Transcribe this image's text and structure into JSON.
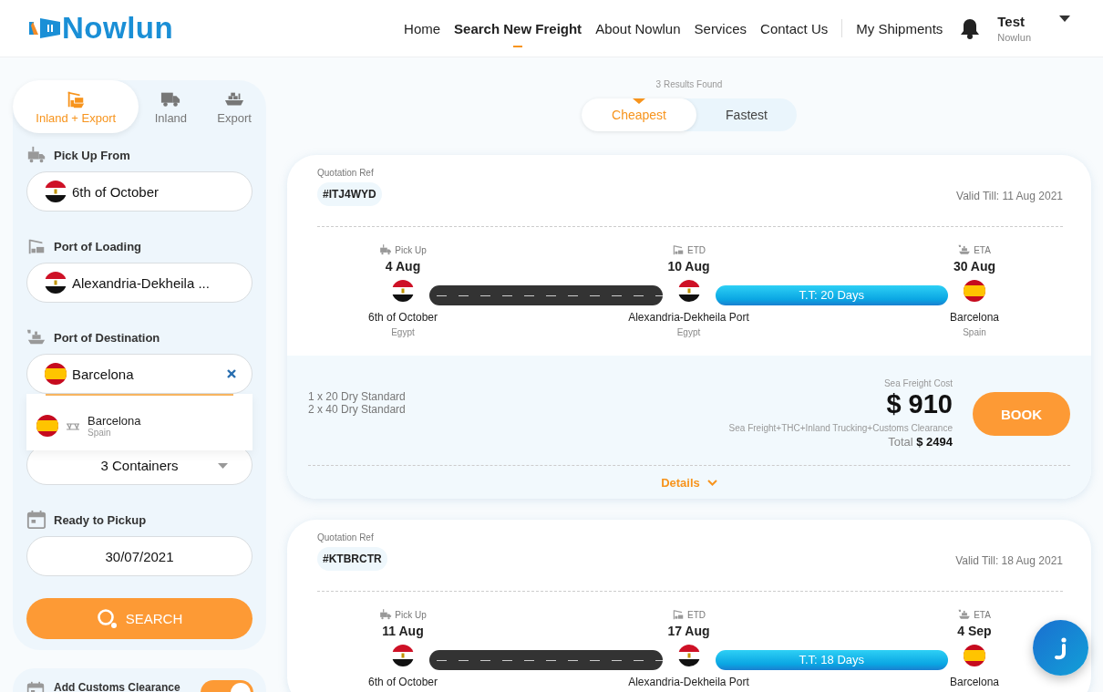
{
  "header": {
    "logo": "Nowlun",
    "nav": [
      {
        "label": "Home",
        "selected": false
      },
      {
        "label": "Search New Freight",
        "selected": true
      },
      {
        "label": "About Nowlun",
        "selected": false
      },
      {
        "label": "Services",
        "selected": false
      },
      {
        "label": "Contact Us",
        "selected": false
      }
    ],
    "my_shipments": "My Shipments",
    "user": {
      "name": "Test",
      "company": "Nowlun"
    }
  },
  "sidebar": {
    "modes": [
      {
        "label": "Inland + Export",
        "selected": true
      },
      {
        "label": "Inland",
        "selected": false
      },
      {
        "label": "Export",
        "selected": false
      }
    ],
    "fields": [
      {
        "kind": "location",
        "label": "Pick Up From",
        "value": "6th of October",
        "flag": {
          "kind": "egypt"
        }
      },
      {
        "kind": "location",
        "label": "Port of Loading",
        "value": "Alexandria-Dekheila ...",
        "flag": {
          "kind": "egypt"
        }
      },
      {
        "kind": "location",
        "label": "Port of Destination",
        "value": "Barcelona",
        "flag": {
          "kind": "spain"
        },
        "clearable": true,
        "suggestions": [
          {
            "name": "Barcelona",
            "country": "Spain",
            "flag": {
              "kind": "spain"
            }
          }
        ]
      },
      {
        "kind": "select",
        "value": "3 Containers"
      },
      {
        "kind": "date",
        "label": "Ready to Pickup",
        "value": "30/07/2021"
      }
    ],
    "search_button": "SEARCH",
    "customs": {
      "label": "Add Customs Clearance",
      "on": true
    }
  },
  "results": {
    "count": "3 Results Found",
    "sort_tabs": [
      {
        "label": "Cheapest",
        "selected": true
      },
      {
        "label": "Fastest",
        "selected": false
      }
    ],
    "quotes": [
      {
        "ref_label": "Quotation Ref",
        "ref": "#ITJ4WYD",
        "valid": "Valid Till: 11 Aug 2021",
        "transit": "T.T: 20 Days",
        "stops": [
          {
            "label": "Pick Up",
            "date": "4 Aug",
            "flag": {
              "kind": "egypt"
            },
            "name": "6th of October",
            "country": "Egypt"
          },
          {
            "label": "ETD",
            "date": "10 Aug",
            "flag": {
              "kind": "egypt"
            },
            "name": "Alexandria-Dekheila Port",
            "country": "Egypt"
          },
          {
            "label": "ETA",
            "date": "30 Aug",
            "flag": {
              "kind": "spain"
            },
            "name": "Barcelona",
            "country": "Spain"
          }
        ],
        "containers": [
          "1 x 20 Dry Standard",
          "2 x 40 Dry Standard"
        ],
        "cost_label": "Sea Freight Cost",
        "price": "$ 910",
        "includes": "Sea Freight+THC+Inland Trucking+Customs Clearance",
        "total_label": "Total",
        "total": "$ 2494",
        "book": "BOOK",
        "details": "Details"
      },
      {
        "ref_label": "Quotation Ref",
        "ref": "#KTBRCTR",
        "valid": "Valid Till: 18 Aug 2021",
        "transit": "T.T: 18 Days",
        "stops": [
          {
            "label": "Pick Up",
            "date": "11 Aug",
            "flag": {
              "kind": "egypt"
            },
            "name": "6th of October"
          },
          {
            "label": "ETD",
            "date": "17 Aug",
            "flag": {
              "kind": "egypt"
            },
            "name": "Alexandria-Dekheila Port"
          },
          {
            "label": "ETA",
            "date": "4 Sep",
            "flag": {
              "kind": "spain"
            },
            "name": "Barcelona"
          }
        ]
      }
    ]
  }
}
